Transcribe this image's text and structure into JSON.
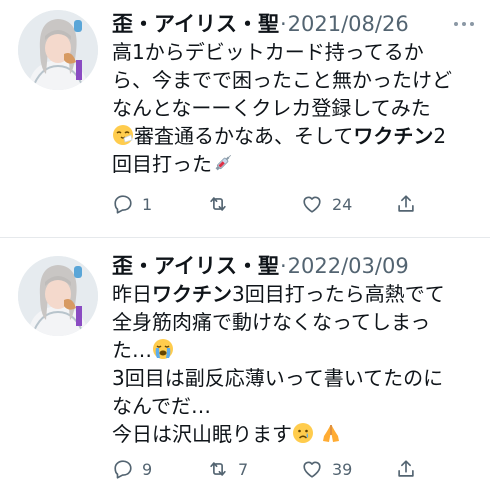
{
  "tweets": [
    {
      "name": "歪・アイリス・聖",
      "separator": "·",
      "date": "2021/08/26",
      "lines": [
        {
          "text": "高1からデビットカード持ってるか"
        },
        {
          "text": "ら、今までで困ったこと無かったけど"
        },
        {
          "text": "なんとなーーくクレカ登録してみた"
        },
        {
          "pre": "審査通るかなあ、そして",
          "bold": "ワクチン",
          "post": "2"
        },
        {
          "text": "回目打った"
        }
      ],
      "emoji": [
        "sneezing-face",
        "syringe"
      ],
      "actions": {
        "reply": "1",
        "retweet": "",
        "like": "24"
      }
    },
    {
      "name": "歪・アイリス・聖",
      "separator": "·",
      "date": "2022/03/09",
      "lines": [
        {
          "pre": "昨日",
          "bold": "ワクチン",
          "post": "3回目打ったら高熱でて"
        },
        {
          "text": "全身筋肉痛で動けなくなってしまっ"
        },
        {
          "text": "た…"
        },
        {
          "text": "3回目は副反応薄いって書いてたのに"
        },
        {
          "text": "なんでだ…"
        },
        {
          "text": "今日は沢山眠ります"
        }
      ],
      "emoji": [
        "loudly-crying-face",
        "crying-face",
        "folded-hands"
      ],
      "actions": {
        "reply": "9",
        "retweet": "7",
        "like": "39"
      }
    }
  ]
}
